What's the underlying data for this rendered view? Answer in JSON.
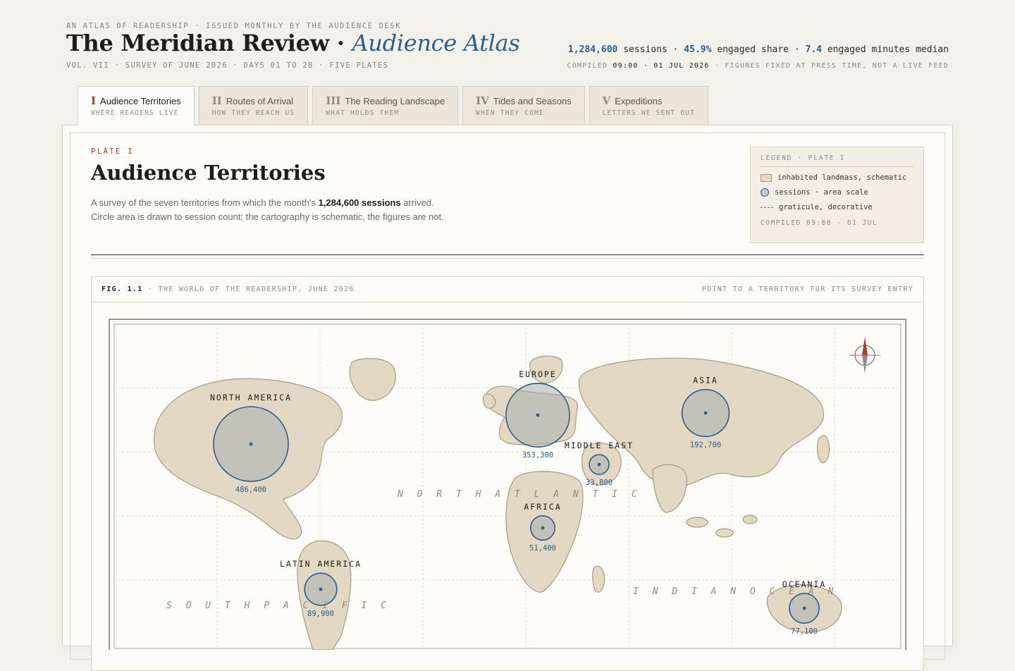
{
  "masthead": {
    "kicker": "AN ATLAS OF READERSHIP · ISSUED MONTHLY BY THE AUDIENCE DESK",
    "title": "The Meridian Review",
    "title_dot": "·",
    "subtitle": "Audience Atlas",
    "volume_line": "VOL. VII · SURVEY OF JUNE 2026 · DAYS 01 TO 28 · FIVE PLATES",
    "stats": {
      "sessions_value": "1,284,600",
      "sessions_label": "sessions ·",
      "engaged_value": "45.9%",
      "engaged_label": "engaged share ·",
      "minutes_value": "7.4",
      "minutes_label": "engaged minutes median"
    },
    "compiled": {
      "prefix": "COMPILED",
      "time": "09:00 · 01 JUL 2026",
      "suffix": "· FIGURES FIXED AT PRESS TIME, NOT A LIVE FEED"
    }
  },
  "tabs": [
    {
      "roman": "I",
      "label": "Audience Territories",
      "sub": "WHERE READERS LIVE",
      "active": true
    },
    {
      "roman": "II",
      "label": "Routes of Arrival",
      "sub": "HOW THEY REACH US",
      "active": false
    },
    {
      "roman": "III",
      "label": "The Reading Landscape",
      "sub": "WHAT HOLDS THEM",
      "active": false
    },
    {
      "roman": "IV",
      "label": "Tides and Seasons",
      "sub": "WHEN THEY COME",
      "active": false
    },
    {
      "roman": "V",
      "label": "Expeditions",
      "sub": "LETTERS WE SENT OUT",
      "active": false
    }
  ],
  "plate": {
    "kicker": "PLATE I",
    "title": "Audience Territories",
    "lede_1a": "A survey of the seven territories from which the month's",
    "lede_1b": "1,284,600 sessions",
    "lede_1c": "arrived.",
    "lede_2": "Circle area is drawn to session count; the cartography is schematic, the figures are not."
  },
  "legend": {
    "title": "LEGEND · PLATE I",
    "land": "inhabited landmass, schematic",
    "circle": "sessions · area scale",
    "graticule": "graticule, decorative",
    "footer": "COMPILED 09:00 · 01 JUL"
  },
  "figure": {
    "label_no": "FIG. 1.1",
    "label_rest": "· THE WORLD OF THE READERSHIP, JUNE 2026",
    "hint": "POINT TO A TERRITORY FOR ITS SURVEY ENTRY",
    "oceans": [
      "N O R T H   A T L A N T I C",
      "I N D I A N   O C E A N",
      "S O U T H   P A C I F I C"
    ]
  },
  "colors": {
    "ink": "#1d1d1b",
    "accent_blue": "#2d5f8a",
    "accent_red": "#b03a2e",
    "land": "#e2d8c3",
    "paper": "#fdfcf8"
  },
  "territories": [
    {
      "name": "NORTH AMERICA",
      "sessions": 486400,
      "value_label": "486,400"
    },
    {
      "name": "EUROPE",
      "sessions": 353300,
      "value_label": "353,300"
    },
    {
      "name": "ASIA",
      "sessions": 192700,
      "value_label": "192,700"
    },
    {
      "name": "LATIN AMERICA",
      "sessions": 89900,
      "value_label": "89,900"
    },
    {
      "name": "OCEANIA",
      "sessions": 77100,
      "value_label": "77,100"
    },
    {
      "name": "AFRICA",
      "sessions": 51400,
      "value_label": "51,400"
    },
    {
      "name": "MIDDLE EAST",
      "sessions": 33800,
      "value_label": "33,800"
    }
  ]
}
